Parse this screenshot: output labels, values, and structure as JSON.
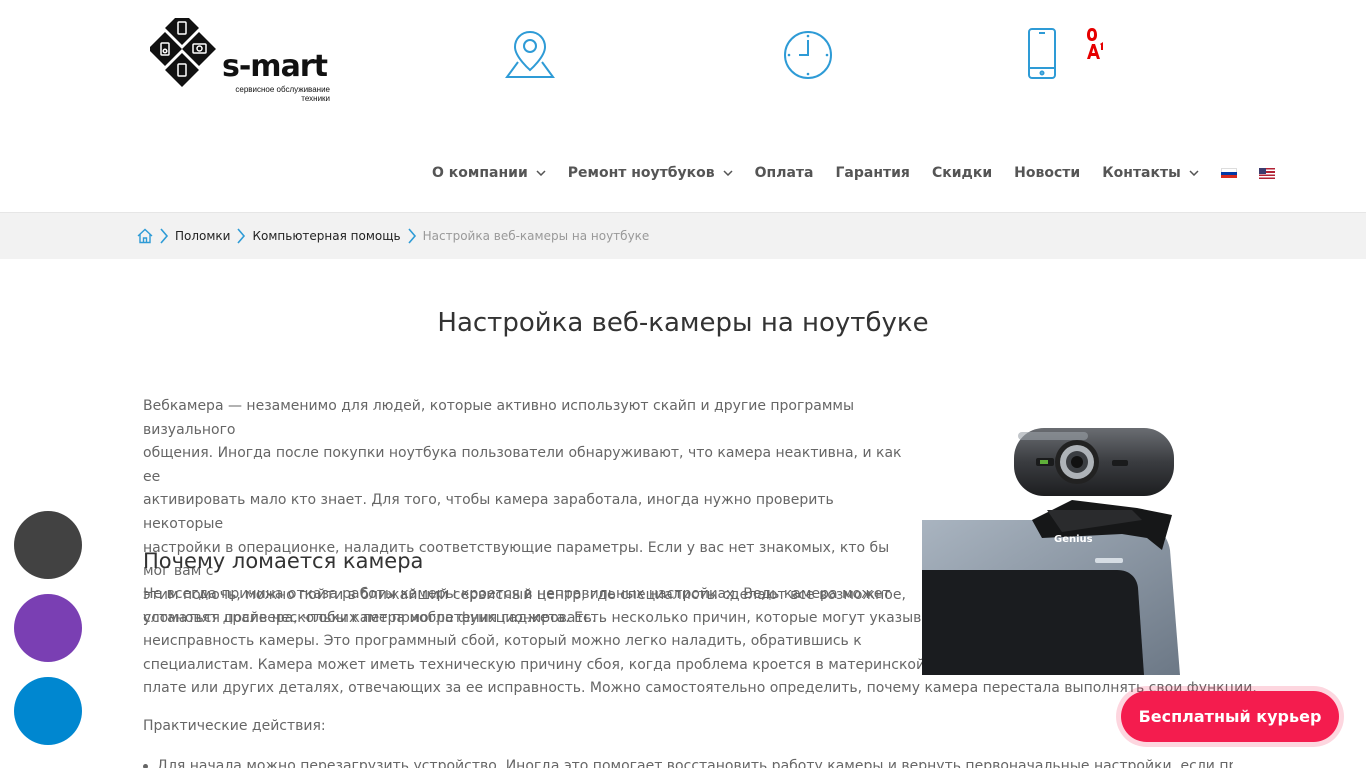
{
  "header": {
    "logo_word": "s-mart",
    "logo_tagline_1": "сервисное обслуживание",
    "logo_tagline_2": "техники",
    "icons": [
      "map-pin-icon",
      "clock-icon",
      "phone-icon"
    ],
    "icon_color": "#2e9bd6",
    "operator_logo": "A1"
  },
  "nav": {
    "items": [
      {
        "label": "О компании",
        "has_dropdown": true
      },
      {
        "label": "Ремонт ноутбуков",
        "has_dropdown": true
      },
      {
        "label": "Оплата",
        "has_dropdown": false
      },
      {
        "label": "Гарантия",
        "has_dropdown": false
      },
      {
        "label": "Скидки",
        "has_dropdown": false
      },
      {
        "label": "Новости",
        "has_dropdown": false
      },
      {
        "label": "Контакты",
        "has_dropdown": true
      }
    ],
    "flags": [
      "ru-flag-icon",
      "us-flag-icon"
    ]
  },
  "breadcrumb": {
    "home_icon": "home-icon",
    "links": [
      "Поломки",
      "Компьютерная помощь"
    ],
    "current": "Настройка веб-камеры на ноутбуке"
  },
  "article": {
    "title": "Настройка веб-камеры на ноутбуке",
    "intro_lines": [
      "Вебкамера — незаменимо для людей, которые активно используют скайп и другие программы визуального",
      "общения. Иногда после покупки ноутбука пользователи обнаруживают, что камера неактивна, и как ее",
      "активировать мало кто знает. Для того, чтобы камера заработала, иногда нужно проверить некоторые",
      "настройки в операционке, наладить соответствующие параметры. Если у вас нет знакомых, кто бы мог вам с",
      "этим помочь, можно пойти в ближайший сервисный центр, где специалисты сделают все возможное,",
      "установят драйвера, чтобы камера могла функционировать."
    ],
    "h2": "Почему ломается камера",
    "reason_lines": [
      "Не всегда причина отказа работы камеры кроется в неправильных настройках. Ведь камера может",
      "сломаться после нескольких лет приобретения гаджета. Есть несколько причин, которые могут указывать на",
      "неисправность камеры. Это программный сбой, который можно легко наладить, обратившись к",
      "специалистам. Камера может иметь техническую причину сбоя, когда проблема кроется в материнской",
      "плате или других деталях, отвечающих за ее исправность. Можно самостоятельно определить, почему камера перестала выполнять свои функции."
    ],
    "practical_label": "Практические действия:",
    "bullet_1": "Для начала можно перезагрузить устройство. Иногда это помогает восстановить работу камеры и вернуть первоначальные настройки, если проблема",
    "image_brand": "Genius"
  },
  "floating": {
    "buttons": [
      {
        "name": "contact-button-dark",
        "color": "#424242"
      },
      {
        "name": "contact-button-purple",
        "color": "#7a3fb3"
      },
      {
        "name": "contact-button-blue",
        "color": "#0087d0"
      }
    ],
    "courier_label": "Бесплатный курьер",
    "courier_color": "#f41c4e"
  }
}
